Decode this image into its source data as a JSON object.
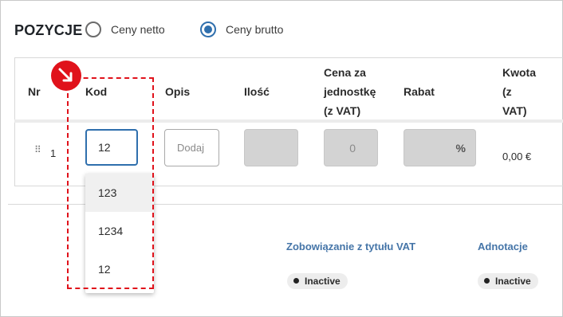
{
  "section": {
    "title": "POZYCJE"
  },
  "price_mode": {
    "netto_label": "Ceny netto",
    "brutto_label": "Ceny brutto",
    "selected": "brutto"
  },
  "table": {
    "headers": {
      "nr": "Nr",
      "kod": "Kod",
      "opis": "Opis",
      "ilosc": "Ilość",
      "cena_line1": "Cena za",
      "cena_line2": "jednostkę",
      "cena_line3": "(z VAT)",
      "rabat": "Rabat",
      "kwota_line1": "Kwota",
      "kwota_line2": "(z",
      "kwota_line3": "VAT)"
    },
    "row": {
      "number": "1",
      "drag_icon": "⠿",
      "kod_value": "12",
      "opis_placeholder": "Dodaj",
      "ilosc_value": "",
      "cena_value": "0",
      "rabat_suffix": "%",
      "amount": "0,00 €"
    }
  },
  "dropdown": {
    "items": [
      "123",
      "1234",
      "12"
    ],
    "highlighted_index": 0
  },
  "footer": {
    "vat_link": "Zobowiązanie z tytułu VAT",
    "vat_status": "Inactive",
    "adnotacje_link": "Adnotacje",
    "adnotacje_status": "Inactive"
  },
  "annotation": {
    "marker_icon": "arrow-down-right-icon",
    "color": "#e0121b"
  },
  "colors": {
    "accent": "#2f6fad",
    "link": "#4575a8"
  }
}
